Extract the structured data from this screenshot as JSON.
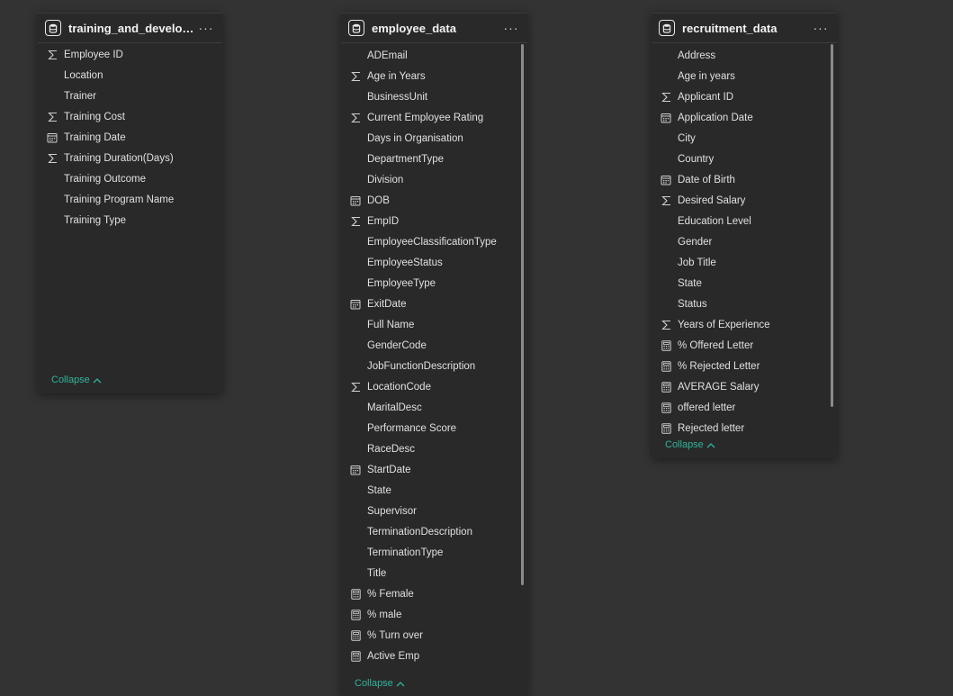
{
  "tables": [
    {
      "title": "training_and_developm...",
      "more_label": "···",
      "collapse_label": "Collapse",
      "fields": [
        {
          "name": "Employee ID",
          "icon": "sigma-icon"
        },
        {
          "name": "Location",
          "icon": "none"
        },
        {
          "name": "Trainer",
          "icon": "none"
        },
        {
          "name": "Training Cost",
          "icon": "sigma-icon"
        },
        {
          "name": "Training Date",
          "icon": "calendar-icon"
        },
        {
          "name": "Training Duration(Days)",
          "icon": "sigma-icon"
        },
        {
          "name": "Training Outcome",
          "icon": "none"
        },
        {
          "name": "Training Program Name",
          "icon": "none"
        },
        {
          "name": "Training Type",
          "icon": "none"
        }
      ]
    },
    {
      "title": "employee_data",
      "more_label": "···",
      "collapse_label": "Collapse",
      "fields": [
        {
          "name": "ADEmail",
          "icon": "none"
        },
        {
          "name": "Age in Years",
          "icon": "sigma-icon"
        },
        {
          "name": "BusinessUnit",
          "icon": "none"
        },
        {
          "name": "Current Employee Rating",
          "icon": "sigma-icon"
        },
        {
          "name": "Days in Organisation",
          "icon": "none"
        },
        {
          "name": "DepartmentType",
          "icon": "none"
        },
        {
          "name": "Division",
          "icon": "none"
        },
        {
          "name": "DOB",
          "icon": "calendar-icon"
        },
        {
          "name": "EmpID",
          "icon": "sigma-icon"
        },
        {
          "name": "EmployeeClassificationType",
          "icon": "none"
        },
        {
          "name": "EmployeeStatus",
          "icon": "none"
        },
        {
          "name": "EmployeeType",
          "icon": "none"
        },
        {
          "name": "ExitDate",
          "icon": "calendar-icon"
        },
        {
          "name": "Full Name",
          "icon": "none"
        },
        {
          "name": "GenderCode",
          "icon": "none"
        },
        {
          "name": "JobFunctionDescription",
          "icon": "none"
        },
        {
          "name": "LocationCode",
          "icon": "sigma-icon"
        },
        {
          "name": "MaritalDesc",
          "icon": "none"
        },
        {
          "name": "Performance Score",
          "icon": "none"
        },
        {
          "name": "RaceDesc",
          "icon": "none"
        },
        {
          "name": "StartDate",
          "icon": "calendar-icon"
        },
        {
          "name": "State",
          "icon": "none"
        },
        {
          "name": "Supervisor",
          "icon": "none"
        },
        {
          "name": "TerminationDescription",
          "icon": "none"
        },
        {
          "name": "TerminationType",
          "icon": "none"
        },
        {
          "name": "Title",
          "icon": "none"
        },
        {
          "name": "% Female",
          "icon": "calculator-icon"
        },
        {
          "name": "% male",
          "icon": "calculator-icon"
        },
        {
          "name": "% Turn over",
          "icon": "calculator-icon"
        },
        {
          "name": "Active Emp",
          "icon": "calculator-icon"
        }
      ]
    },
    {
      "title": "recruitment_data",
      "more_label": "···",
      "collapse_label": "Collapse",
      "fields": [
        {
          "name": "Address",
          "icon": "none"
        },
        {
          "name": "Age in years",
          "icon": "none"
        },
        {
          "name": "Applicant ID",
          "icon": "sigma-icon"
        },
        {
          "name": "Application Date",
          "icon": "calendar-icon"
        },
        {
          "name": "City",
          "icon": "none"
        },
        {
          "name": "Country",
          "icon": "none"
        },
        {
          "name": "Date of Birth",
          "icon": "calendar-icon"
        },
        {
          "name": "Desired Salary",
          "icon": "sigma-icon"
        },
        {
          "name": "Education Level",
          "icon": "none"
        },
        {
          "name": "Gender",
          "icon": "none"
        },
        {
          "name": "Job Title",
          "icon": "none"
        },
        {
          "name": "State",
          "icon": "none"
        },
        {
          "name": "Status",
          "icon": "none"
        },
        {
          "name": "Years of Experience",
          "icon": "sigma-icon"
        },
        {
          "name": "% Offered Letter",
          "icon": "calculator-icon"
        },
        {
          "name": "% Rejected Letter",
          "icon": "calculator-icon"
        },
        {
          "name": "AVERAGE Salary",
          "icon": "calculator-icon"
        },
        {
          "name": "offered letter",
          "icon": "calculator-icon"
        },
        {
          "name": "Rejected letter",
          "icon": "calculator-icon"
        }
      ]
    }
  ],
  "colors": {
    "canvas": "#333333",
    "card": "#292929",
    "text": "#e0e0e0",
    "accent": "#30b39a"
  }
}
